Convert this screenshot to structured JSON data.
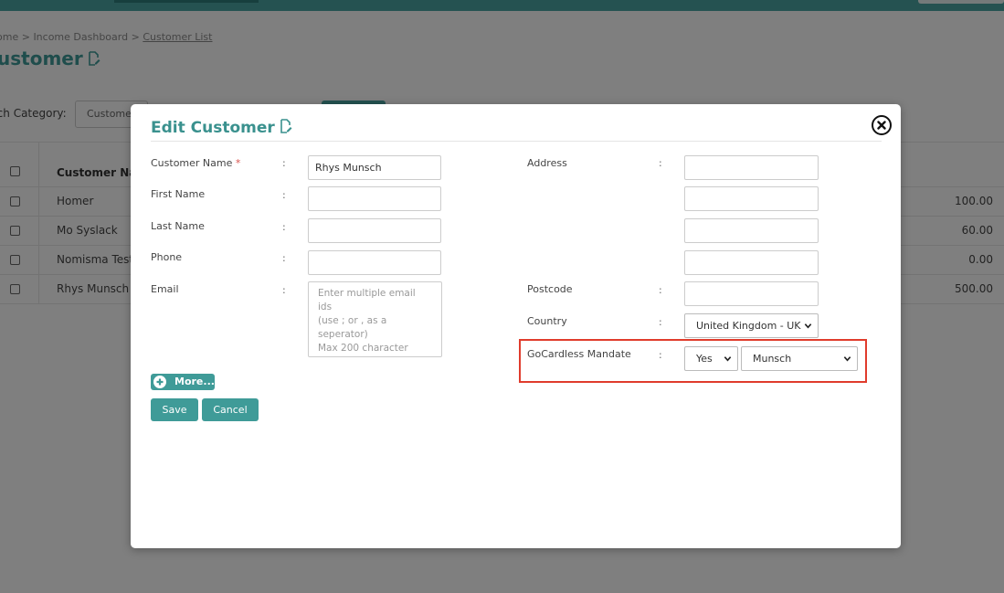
{
  "background": {
    "breadcrumb": {
      "home": "ome",
      "sep1": ">",
      "income": "Income Dashboard",
      "sep2": ">",
      "current": "Customer List"
    },
    "page_title": "ustomer",
    "search_category_label": "rch Category:",
    "search_category_value": "Custome",
    "table": {
      "header_name": "Customer Na",
      "rows": [
        {
          "name": "Homer",
          "amount": "100.00"
        },
        {
          "name": "Mo Syslack",
          "amount": "60.00"
        },
        {
          "name": "Nomisma Test",
          "amount": "0.00"
        },
        {
          "name": "Rhys Munsch",
          "amount": "500.00"
        }
      ]
    }
  },
  "modal": {
    "title": "Edit Customer",
    "fields": {
      "customer_name": {
        "label": "Customer Name",
        "required": "*",
        "value": "Rhys Munsch"
      },
      "first_name": {
        "label": "First Name",
        "value": ""
      },
      "last_name": {
        "label": "Last Name",
        "value": ""
      },
      "phone": {
        "label": "Phone",
        "value": ""
      },
      "email": {
        "label": "Email",
        "placeholder_line1": "Enter multiple email ids",
        "placeholder_line2": "(use ; or , as a seperator)",
        "placeholder_line3": "Max 200 character"
      },
      "address": {
        "label": "Address"
      },
      "postcode": {
        "label": "Postcode",
        "value": ""
      },
      "country": {
        "label": "Country",
        "value": "United Kingdom - UK"
      },
      "gocardless_mandate": {
        "label": "GoCardless Mandate",
        "enabled_value": "Yes",
        "mandate_value": "Munsch"
      }
    },
    "colon": ":",
    "more_label": "More...",
    "save_label": "Save",
    "cancel_label": "Cancel"
  },
  "colors": {
    "accent": "#3f9b98",
    "highlight": "#e03c2c",
    "required": "#d9534f"
  },
  "icons": [
    "edit-document-icon",
    "close-icon",
    "chevron-down-icon",
    "plus-circle-icon"
  ]
}
